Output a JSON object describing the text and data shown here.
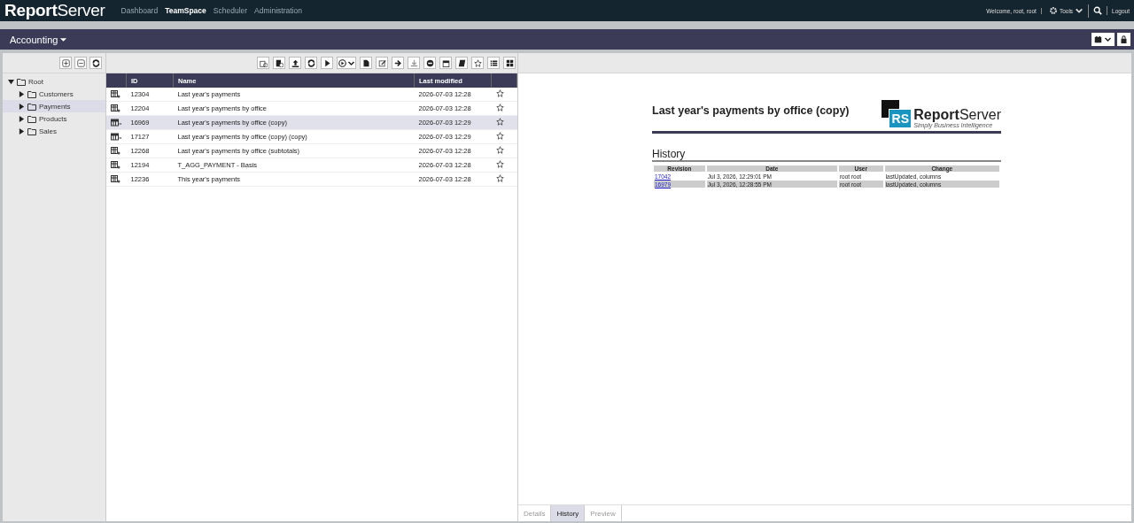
{
  "app": {
    "logo": "**Report**Server",
    "nav": [
      {
        "label": "Dashboard",
        "selected": false
      },
      {
        "label": "TeamSpace",
        "selected": true
      },
      {
        "label": "Scheduler",
        "selected": false
      },
      {
        "label": "Administration",
        "selected": false
      }
    ],
    "welcome": "Welcome, root, root",
    "tools": "Tools",
    "logout": "Logout"
  },
  "teamspace": {
    "title": "Accounting"
  },
  "tree": [
    {
      "label": "Root",
      "expanded": true,
      "selected": false,
      "children": [
        {
          "label": "Customers",
          "expanded": false,
          "selected": false
        },
        {
          "label": "Payments",
          "expanded": false,
          "selected": true
        },
        {
          "label": "Products",
          "expanded": false,
          "selected": false
        },
        {
          "label": "Sales",
          "expanded": false,
          "selected": false
        }
      ]
    }
  ],
  "table": {
    "columns": [
      "ID",
      "Name",
      "Last modified"
    ],
    "rows": [
      {
        "kind": "report",
        "id": "12304",
        "name": "Last year's payments",
        "modified": "2026-07-03 12:28",
        "selected": false
      },
      {
        "kind": "report",
        "id": "12204",
        "name": "Last year's payments by office",
        "modified": "2026-07-03 12:28",
        "selected": false
      },
      {
        "kind": "table",
        "id": "16969",
        "name": "Last year's payments by office (copy)",
        "modified": "2026-07-03 12:29",
        "selected": true
      },
      {
        "kind": "table",
        "id": "17127",
        "name": "Last year's payments by office (copy) (copy)",
        "modified": "2026-07-03 12:29",
        "selected": false
      },
      {
        "kind": "report",
        "id": "12268",
        "name": "Last year's payments by office (subtotals)",
        "modified": "2026-07-03 12:28",
        "selected": false
      },
      {
        "kind": "report",
        "id": "12194",
        "name": "T_AGG_PAYMENT - Basis",
        "modified": "2026-07-03 12:28",
        "selected": false
      },
      {
        "kind": "report",
        "id": "12236",
        "name": "This year's payments",
        "modified": "2026-07-03 12:28",
        "selected": false
      }
    ]
  },
  "preview": {
    "title": "Last year's payments by office (copy)",
    "logo_mark": "RS",
    "logo": "**Report**Server",
    "tagline": "Simply Business Intelligence",
    "history_title": "History",
    "history_columns": [
      "Revision",
      "Date",
      "User",
      "Change"
    ],
    "history_rows": [
      {
        "revision": "17042",
        "date": "Jul 3, 2026, 12:29:01 PM",
        "user": "root root",
        "change": "lastUpdated, columns"
      },
      {
        "revision": "16979",
        "date": "Jul 3, 2026, 12:28:55 PM",
        "user": "root root",
        "change": "lastUpdated, columns"
      }
    ]
  },
  "tabs": [
    {
      "label": "Details",
      "selected": false
    },
    {
      "label": "History",
      "selected": true
    },
    {
      "label": "Preview",
      "selected": false
    }
  ]
}
